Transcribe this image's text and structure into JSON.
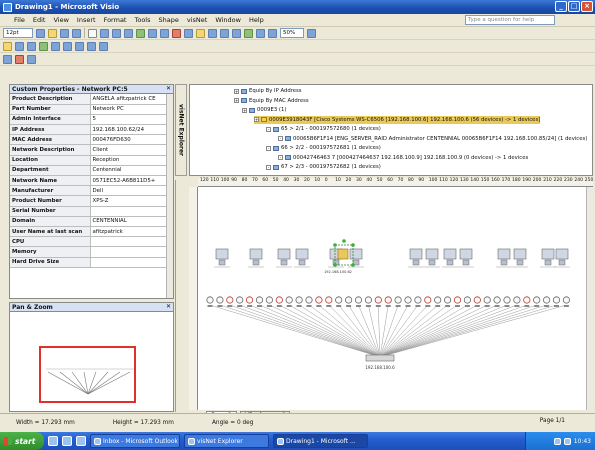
{
  "window": {
    "title": "Drawing1 - Microsoft Visio",
    "controls": [
      "_",
      "□",
      "×"
    ]
  },
  "menu": {
    "items": [
      "File",
      "Edit",
      "View",
      "Insert",
      "Format",
      "Tools",
      "Shape",
      "visNet",
      "Window",
      "Help"
    ],
    "help_placeholder": "Type a question for help"
  },
  "toolbar": {
    "font_size": "12pt",
    "zoom": "50%"
  },
  "properties": {
    "title": "Custom Properties - Network PC:5",
    "rows": [
      {
        "k": "Product Description",
        "v": "ANGELA afitzpatrick CE"
      },
      {
        "k": "Part Number",
        "v": "Network PC"
      },
      {
        "k": "Admin Interface",
        "v": "5"
      },
      {
        "k": "IP Address",
        "v": "192.168.100.62/24"
      },
      {
        "k": "MAC Address",
        "v": "000476FD630"
      },
      {
        "k": "Network Description",
        "v": "Client"
      },
      {
        "k": "Location",
        "v": "Reception"
      },
      {
        "k": "Department",
        "v": "Centennial"
      },
      {
        "k": "Network Name",
        "v": "0571EC52-A6B811D5+"
      },
      {
        "k": "Manufacturer",
        "v": "Dell"
      },
      {
        "k": "Product Number",
        "v": "XPS-Z"
      },
      {
        "k": "Serial Number",
        "v": ""
      },
      {
        "k": "Domain",
        "v": "CENTENNIAL"
      },
      {
        "k": "User Name at last scan",
        "v": "afitzpatrick"
      },
      {
        "k": "CPU",
        "v": ""
      },
      {
        "k": "Memory",
        "v": ""
      },
      {
        "k": "Hard Drive Size",
        "v": ""
      }
    ]
  },
  "pan": {
    "title": "Pan & Zoom"
  },
  "explorer": {
    "tab_label": "visNet Explorer",
    "tree": [
      {
        "t": "Equip By IP Address"
      },
      {
        "t": "Equip By MAC Address"
      },
      {
        "t": "0009E3 (1)"
      },
      {
        "t": "0009E3918043F [Cisco Systems WS-C6506 [192.168.100.6] 192.168.100.6 (56 devices) -> 1 devices]"
      },
      {
        "t": "65 > 2/1 - 000197572680 (1 devices)"
      },
      {
        "t": "00065B6F1F14 [ENG_SERVER_RAID Administrator CENTENNIAL 00065B6F1F14 192.168.100.85/24] (1 devices)"
      },
      {
        "t": "66 > 2/2 - 000197572681 (1 devices)"
      },
      {
        "t": "00042746463 7 [000427464637 192.168.100.9] 192.168.100.9 (0 devices) -> 1 devices"
      },
      {
        "t": "67 > 2/3 - 000197572682 (1 devices)"
      }
    ]
  },
  "ruler": {
    "ticks": [
      "120",
      "110",
      "100",
      "90",
      "80",
      "70",
      "60",
      "50",
      "40",
      "30",
      "20",
      "10",
      "0",
      "10",
      "20",
      "30",
      "40",
      "50",
      "60",
      "70",
      "80",
      "90",
      "100",
      "110",
      "120",
      "130",
      "140",
      "150",
      "160",
      "170",
      "180",
      "190",
      "200",
      "210",
      "220",
      "230",
      "240",
      "250"
    ]
  },
  "diagram": {
    "hub_label": "192.168.100.6",
    "pc_label": "192.168.100.62"
  },
  "pages": {
    "active": "Page-1",
    "bg": "VBackground"
  },
  "status": {
    "width": "Width = 17.293 mm",
    "height": "Height = 17.293 mm",
    "angle": "Angle = 0 deg",
    "page": "Page 1/1"
  },
  "taskbar": {
    "start": "start",
    "tasks": [
      {
        "label": "Inbox - Microsoft Outlook",
        "active": false
      },
      {
        "label": "visNet Explorer",
        "active": false
      },
      {
        "label": "Drawing1 - Microsoft ...",
        "active": true
      }
    ],
    "time": "10:43"
  }
}
